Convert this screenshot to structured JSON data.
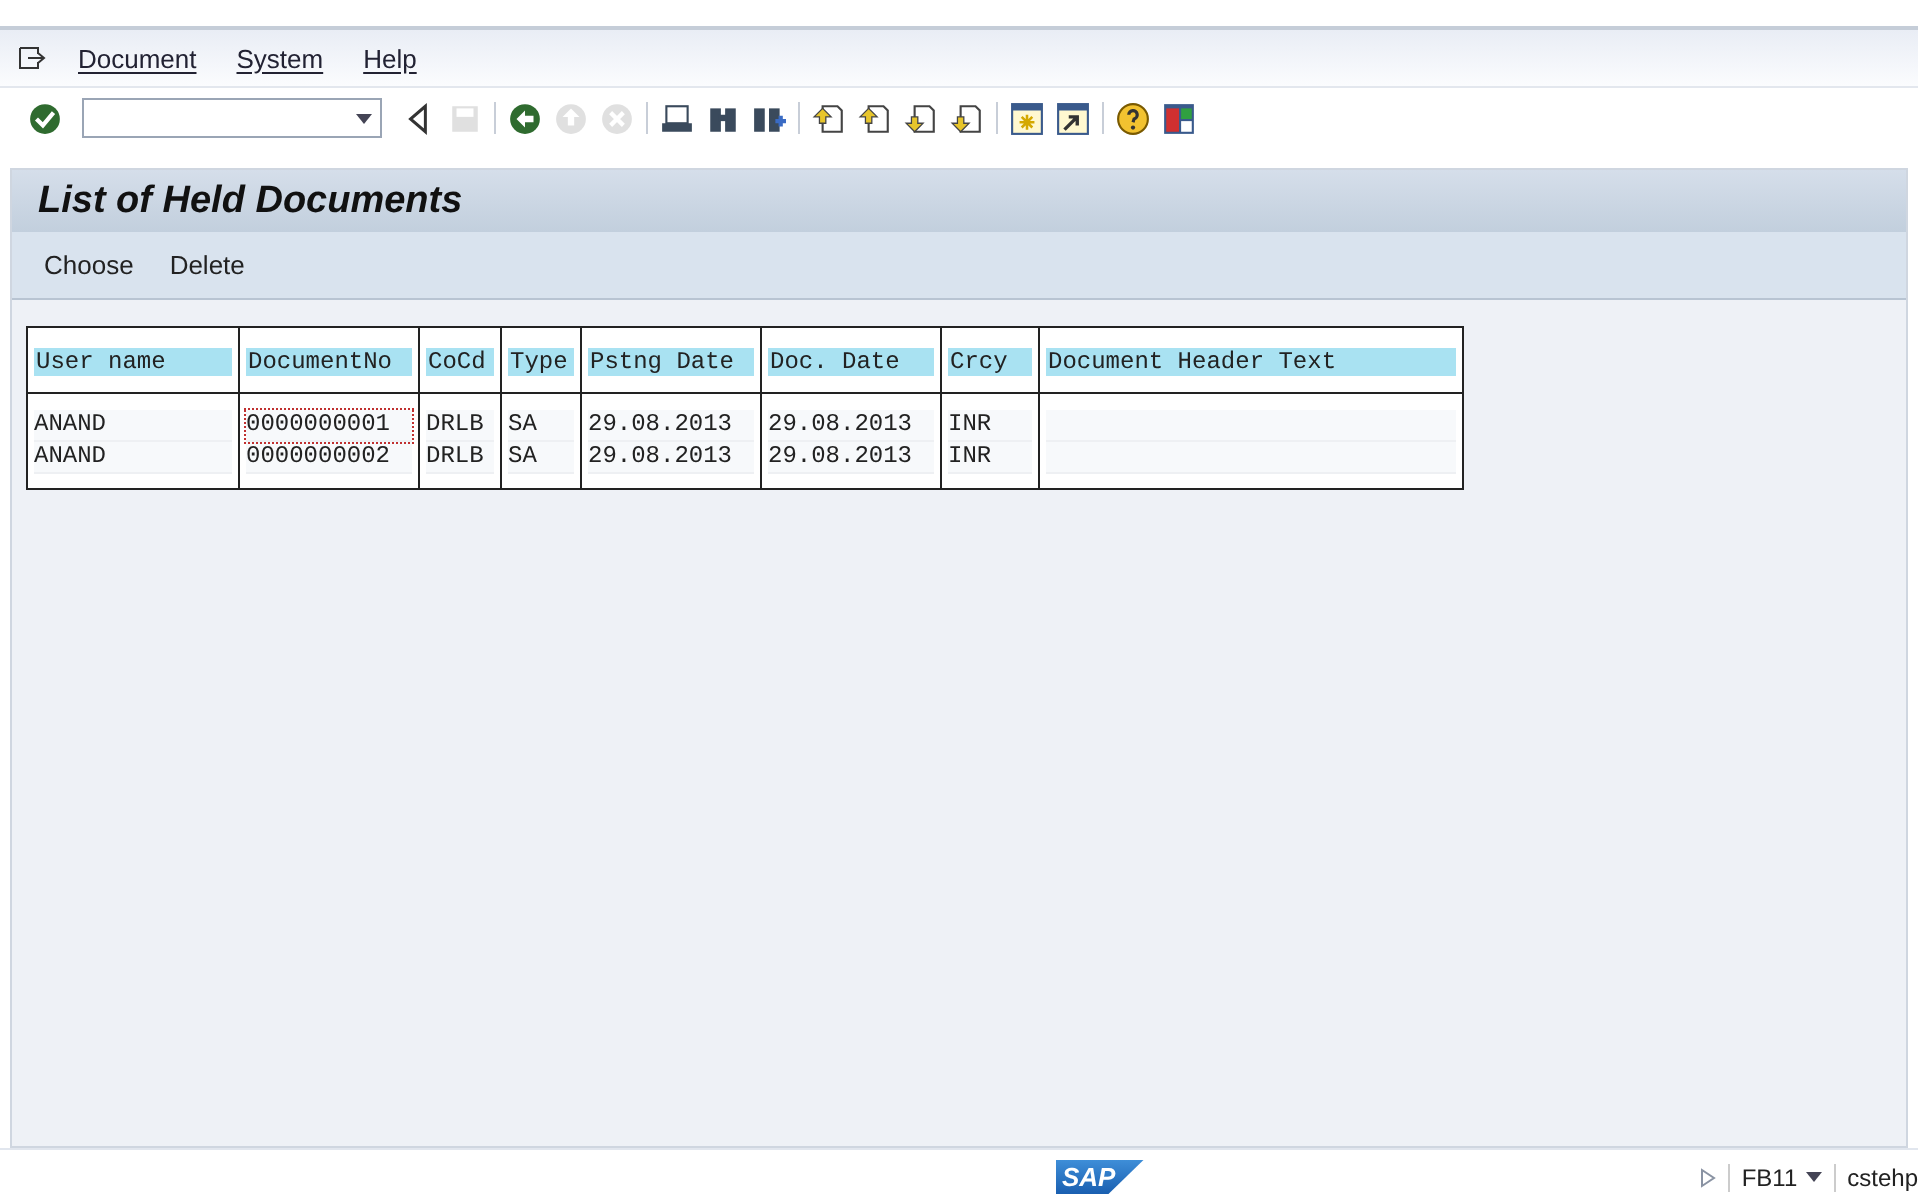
{
  "menu": {
    "items": [
      "Document",
      "System",
      "Help"
    ]
  },
  "toolbar": {
    "buttons": [
      {
        "kind": "enter",
        "disabled": false
      },
      {
        "kind": "collapse",
        "disabled": false
      },
      {
        "kind": "save",
        "disabled": true
      },
      {
        "kind": "back",
        "disabled": false
      },
      {
        "kind": "exit",
        "disabled": true
      },
      {
        "kind": "cancel",
        "disabled": true
      },
      {
        "kind": "print",
        "disabled": false
      },
      {
        "kind": "find",
        "disabled": false
      },
      {
        "kind": "find-next",
        "disabled": false
      },
      {
        "kind": "first-page",
        "disabled": false
      },
      {
        "kind": "previous-page",
        "disabled": false
      },
      {
        "kind": "next-page",
        "disabled": false
      },
      {
        "kind": "last-page",
        "disabled": false
      },
      {
        "kind": "new-session",
        "disabled": false
      },
      {
        "kind": "shortcut",
        "disabled": false
      },
      {
        "kind": "help",
        "disabled": false
      },
      {
        "kind": "layout",
        "disabled": false
      }
    ]
  },
  "title": "List of Held Documents",
  "app_toolbar": [
    "Choose",
    "Delete"
  ],
  "table": {
    "columns": [
      "User name",
      "DocumentNo",
      "CoCd",
      "Type",
      "Pstng Date",
      "Doc. Date",
      "Crcy",
      "Document Header Text"
    ],
    "rows": [
      {
        "selected": true,
        "cells": [
          "ANAND",
          "0000000001",
          "DRLB",
          "SA",
          "29.08.2013",
          "29.08.2013",
          "INR",
          ""
        ]
      },
      {
        "selected": false,
        "cells": [
          "ANAND",
          "0000000002",
          "DRLB",
          "SA",
          "29.08.2013",
          "29.08.2013",
          "INR",
          ""
        ]
      }
    ]
  },
  "status_bar": {
    "logo": "SAP",
    "transaction": "FB11",
    "server": "cstehp"
  }
}
